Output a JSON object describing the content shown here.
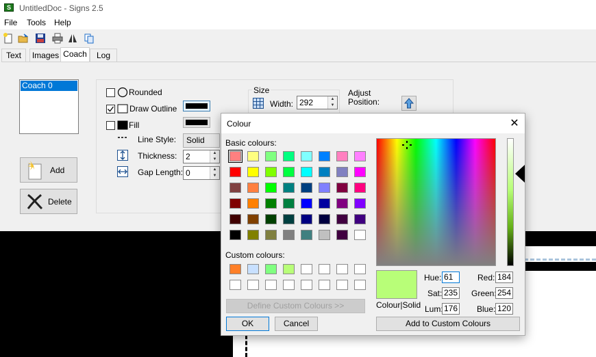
{
  "window": {
    "title": "UntitledDoc - Signs 2.5",
    "icon_letter": "S"
  },
  "menu": {
    "items": [
      "File",
      "Tools",
      "Help"
    ]
  },
  "toolbar": {
    "icons": [
      "new-icon",
      "open-icon",
      "save-icon",
      "print-icon",
      "mirror-icon",
      "copy-icon"
    ]
  },
  "tabs": [
    "Text",
    "Images",
    "Coach",
    "Log"
  ],
  "active_tab": "Coach",
  "coach": {
    "list": [
      "Coach 0"
    ],
    "add_label": "Add",
    "delete_label": "Delete",
    "rounded_label": "Rounded",
    "rounded_checked": false,
    "draw_outline_label": "Draw Outline",
    "draw_outline_checked": true,
    "fill_label": "Fill",
    "fill_checked": false,
    "line_style_label": "Line Style:",
    "line_style_value": "Solid",
    "thickness_label": "Thickness:",
    "thickness_value": "2",
    "gap_length_label": "Gap Length:",
    "gap_length_value": "0",
    "size_label": "Size",
    "width_label": "Width:",
    "width_value": "292",
    "adjust_label": "Adjust",
    "position_label": "Position:",
    "outline_colour": "#000000",
    "fill_colour": "#000000"
  },
  "dialog": {
    "title": "Colour",
    "basic_label": "Basic colours:",
    "custom_label": "Custom colours:",
    "define_label": "Define Custom Colours >>",
    "ok_label": "OK",
    "cancel_label": "Cancel",
    "add_custom_label": "Add to Custom Colours",
    "colour_solid_label": "Colour|Solid",
    "hue_label": "Hue:",
    "hue": "61",
    "sat_label": "Sat:",
    "sat": "235",
    "lum_label": "Lum:",
    "lum": "176",
    "red_label": "Red:",
    "red": "184",
    "green_label": "Green:",
    "green": "254",
    "blue_label": "Blue:",
    "blue": "120",
    "current_colour": "#b8fe78",
    "basic_colours": [
      [
        "#ff8080",
        "#ffff80",
        "#80ff80",
        "#00ff80",
        "#80ffff",
        "#0080ff",
        "#ff80c0",
        "#ff80ff"
      ],
      [
        "#ff0000",
        "#ffff00",
        "#80ff00",
        "#00ff40",
        "#00ffff",
        "#0080c0",
        "#8080c0",
        "#ff00ff"
      ],
      [
        "#804040",
        "#ff8040",
        "#00ff00",
        "#008080",
        "#004080",
        "#8080ff",
        "#800040",
        "#ff0080"
      ],
      [
        "#800000",
        "#ff8000",
        "#008000",
        "#008040",
        "#0000ff",
        "#0000a0",
        "#800080",
        "#8000ff"
      ],
      [
        "#400000",
        "#804000",
        "#004000",
        "#004040",
        "#000080",
        "#000040",
        "#400040",
        "#400080"
      ],
      [
        "#000000",
        "#808000",
        "#808040",
        "#808080",
        "#408080",
        "#c0c0c0",
        "#400040",
        "#ffffff"
      ]
    ],
    "custom_colours": [
      [
        "#ff7f27",
        "#c8e0ff",
        "#80ff80",
        "#b8fe78",
        "#ffffff",
        "#ffffff",
        "#ffffff",
        "#ffffff"
      ],
      [
        "#ffffff",
        "#ffffff",
        "#ffffff",
        "#ffffff",
        "#ffffff",
        "#ffffff",
        "#ffffff",
        "#ffffff"
      ]
    ]
  }
}
